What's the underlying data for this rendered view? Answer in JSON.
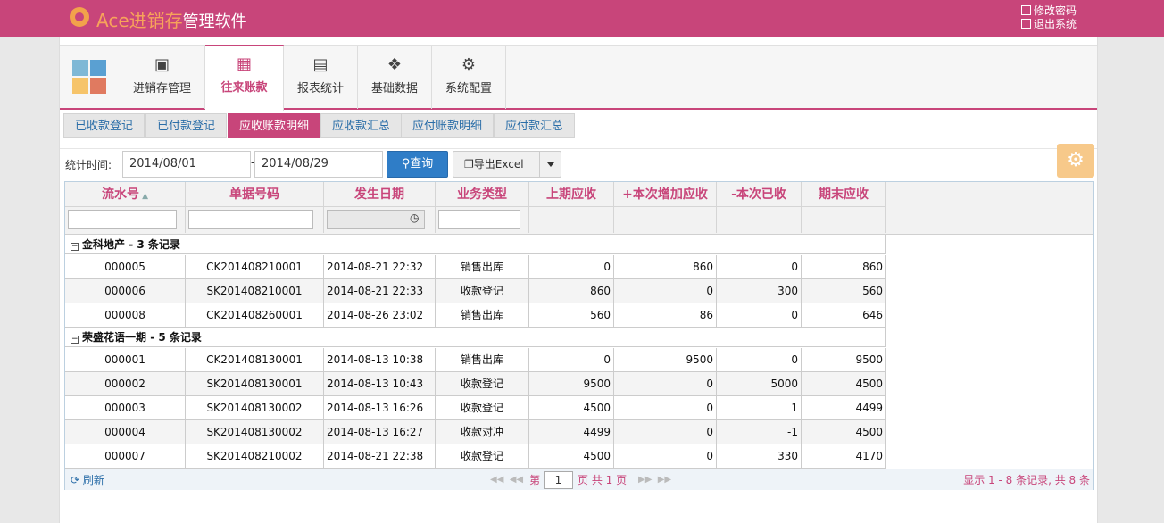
{
  "header": {
    "brand_ace": "Ace进销存",
    "brand_sub": "管理软件",
    "change_password": "修改密码",
    "logout": "退出系统"
  },
  "nav": {
    "items": [
      {
        "label": "进销存管理",
        "icon": "cube-icon"
      },
      {
        "label": "往来账款",
        "icon": "calculator-icon"
      },
      {
        "label": "报表统计",
        "icon": "bar-chart-icon"
      },
      {
        "label": "基础数据",
        "icon": "puzzle-icon"
      },
      {
        "label": "系统配置",
        "icon": "gear-icon"
      }
    ],
    "active": "往来账款"
  },
  "subtabs": {
    "items": [
      "已收款登记",
      "已付款登记",
      "应收账款明细",
      "应收款汇总",
      "应付账款明细",
      "应付款汇总"
    ],
    "active": "应收账款明细"
  },
  "filters": {
    "label": "统计时间:",
    "date_from": "2014/08/01",
    "separator": "-",
    "date_to": "2014/08/29",
    "query_button": "查询",
    "export_button": "导出Excel"
  },
  "grid": {
    "columns": [
      "流水号",
      "单据号码",
      "发生日期",
      "业务类型",
      "上期应收",
      "+本次增加应收",
      "-本次已收",
      "期末应收"
    ],
    "groups": [
      {
        "title": "金科地产",
        "count_text": " - 3 条记录",
        "rows": [
          [
            "000005",
            "CK201408210001",
            "2014-08-21 22:32",
            "销售出库",
            "0",
            "860",
            "0",
            "860"
          ],
          [
            "000006",
            "SK201408210001",
            "2014-08-21 22:33",
            "收款登记",
            "860",
            "0",
            "300",
            "560"
          ],
          [
            "000008",
            "CK201408260001",
            "2014-08-26 23:02",
            "销售出库",
            "560",
            "86",
            "0",
            "646"
          ]
        ]
      },
      {
        "title": "荣盛花语一期",
        "count_text": " - 5 条记录",
        "rows": [
          [
            "000001",
            "CK201408130001",
            "2014-08-13 10:38",
            "销售出库",
            "0",
            "9500",
            "0",
            "9500"
          ],
          [
            "000002",
            "SK201408130001",
            "2014-08-13 10:43",
            "收款登记",
            "9500",
            "0",
            "5000",
            "4500"
          ],
          [
            "000003",
            "SK201408130002",
            "2014-08-13 16:26",
            "收款登记",
            "4500",
            "0",
            "1",
            "4499"
          ],
          [
            "000004",
            "SK201408130002",
            "2014-08-13 16:27",
            "收款对冲",
            "4499",
            "0",
            "-1",
            "4500"
          ],
          [
            "000007",
            "SK201408210002",
            "2014-08-21 22:38",
            "收款登记",
            "4500",
            "0",
            "330",
            "4170"
          ]
        ]
      }
    ]
  },
  "pager": {
    "refresh": "刷新",
    "page_prefix": "第",
    "page_value": "1",
    "page_suffix": "页 共 1 页",
    "info": "显示 1 - 8 条记录, 共 8 条"
  },
  "colors": {
    "brand": "#c8457a",
    "accent_blue": "#2f7dc7",
    "logo_orange": "#f2a24b"
  }
}
